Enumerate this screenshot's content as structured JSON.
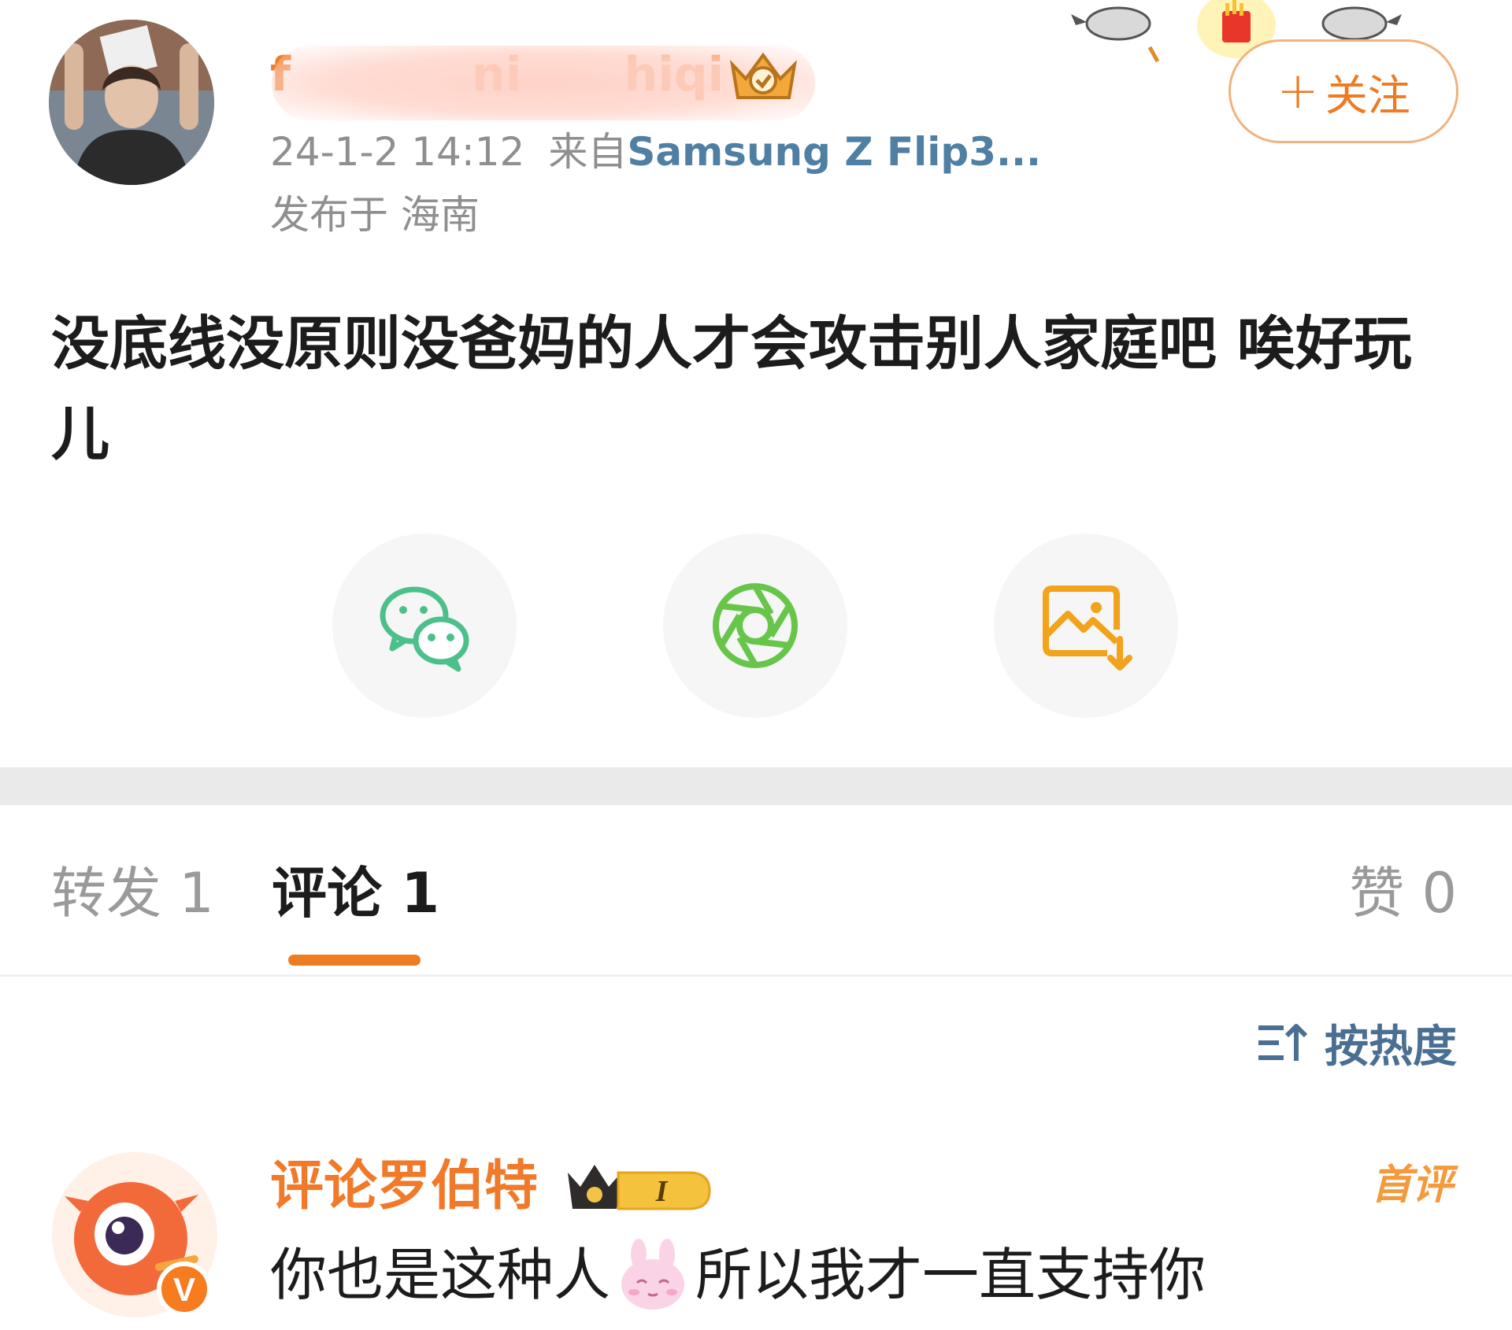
{
  "post": {
    "author": {
      "name_fragments": [
        "f",
        "ni",
        "hiqi"
      ],
      "timestamp": "24-1-2 14:12",
      "source_prefix": "来自",
      "device": "Samsung Z Flip3...",
      "location_prefix": "发布于",
      "location": "海南"
    },
    "follow_button": {
      "plus": "+",
      "label": "关注"
    },
    "text": "没底线没原则没爸妈的人才会攻击别人家庭吧 唉好玩儿",
    "share": [
      {
        "name": "wechat",
        "icon": "wechat-icon",
        "color": "#4cc08a"
      },
      {
        "name": "moments",
        "icon": "moments-shutter-icon",
        "color": "#67c54a"
      },
      {
        "name": "save-image",
        "icon": "save-image-icon",
        "color": "#f2a21b"
      }
    ]
  },
  "tabs": {
    "repost": "转发 1",
    "comment": "评论 1",
    "like": "赞 0"
  },
  "sort": {
    "icon": "sort-icon",
    "label": "按热度"
  },
  "comment": {
    "username": "评论罗伯特",
    "level_badge": "I",
    "first_badge": "首评",
    "text_before": "你也是这种人",
    "emoji": "bunny-emoji",
    "text_after": "所以我才一直支持你",
    "avatar_badge": "V"
  },
  "colors": {
    "accent_orange": "#ee7d22",
    "link_blue": "#4f7fa3",
    "muted_gray": "#8f8f8f"
  }
}
